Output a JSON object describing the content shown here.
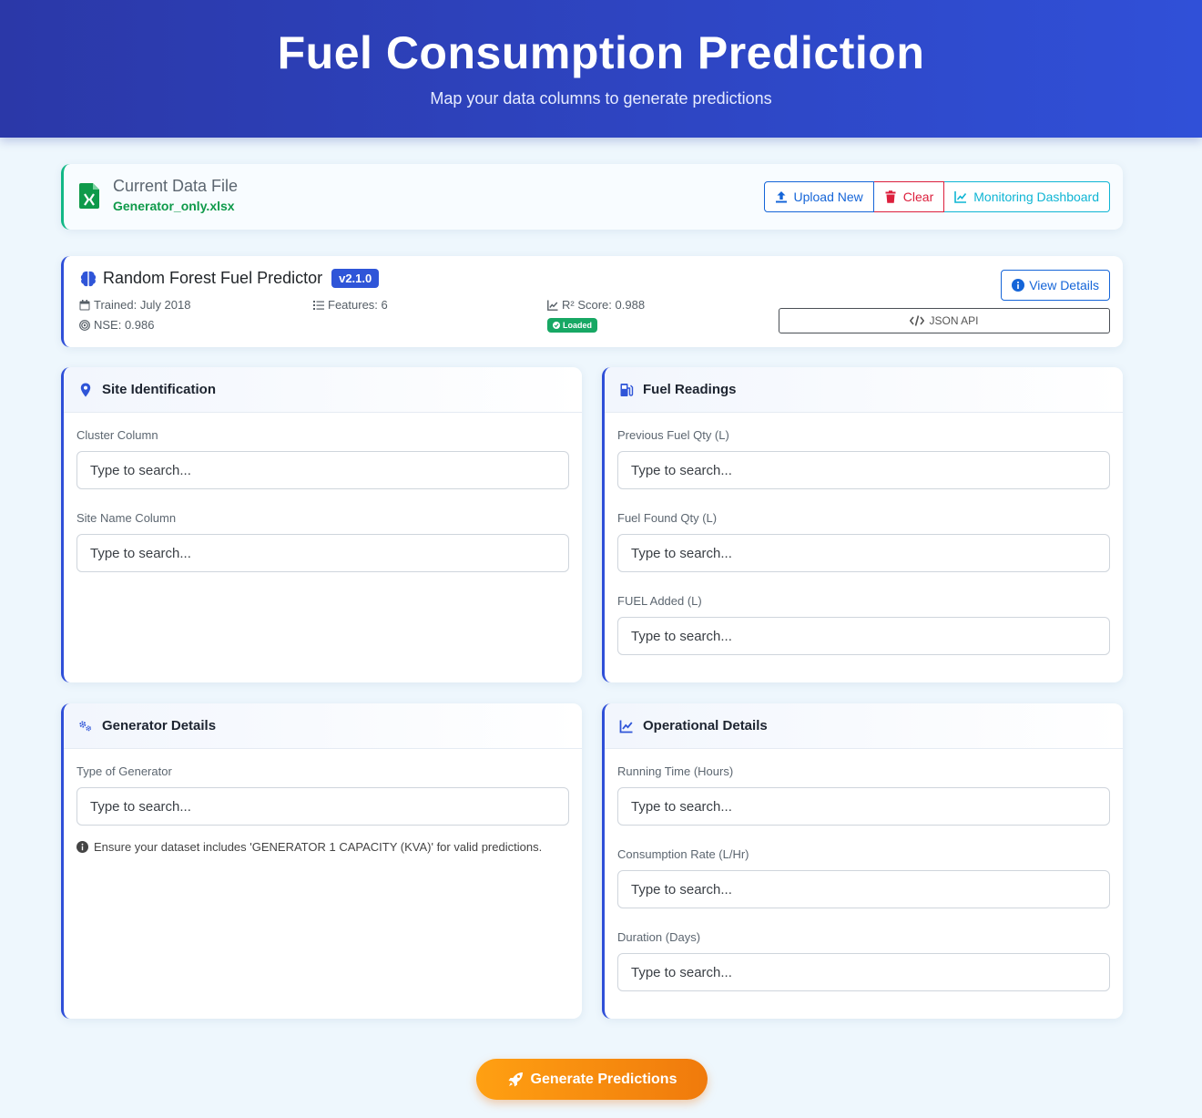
{
  "header": {
    "title": "Fuel Consumption Prediction",
    "subtitle": "Map your data columns to generate predictions"
  },
  "file": {
    "title": "Current Data File",
    "name": "Generator_only.xlsx",
    "buttons": {
      "upload": "Upload New",
      "clear": "Clear",
      "monitor": "Monitoring Dashboard"
    }
  },
  "model": {
    "name": "Random Forest Fuel Predictor",
    "version": "v2.1.0",
    "trained": "Trained: July 2018",
    "features": "Features: 6",
    "r2": "R² Score: 0.988",
    "nse": "NSE: 0.986",
    "status": "Loaded",
    "view_details": "View Details",
    "json_api": "JSON API"
  },
  "sections": {
    "site": {
      "title": "Site Identification",
      "fields": [
        {
          "label": "Cluster Column",
          "placeholder": "Type to search..."
        },
        {
          "label": "Site Name Column",
          "placeholder": "Type to search..."
        }
      ]
    },
    "fuel": {
      "title": "Fuel Readings",
      "fields": [
        {
          "label": "Previous Fuel Qty (L)",
          "placeholder": "Type to search..."
        },
        {
          "label": "Fuel Found Qty (L)",
          "placeholder": "Type to search..."
        },
        {
          "label": "FUEL Added (L)",
          "placeholder": "Type to search..."
        }
      ]
    },
    "generator": {
      "title": "Generator Details",
      "fields": [
        {
          "label": "Type of Generator",
          "placeholder": "Type to search..."
        }
      ],
      "note": "Ensure your dataset includes 'GENERATOR 1 CAPACITY (KVA)' for valid predictions."
    },
    "operational": {
      "title": "Operational Details",
      "fields": [
        {
          "label": "Running Time (Hours)",
          "placeholder": "Type to search..."
        },
        {
          "label": "Consumption Rate (L/Hr)",
          "placeholder": "Type to search..."
        },
        {
          "label": "Duration (Days)",
          "placeholder": "Type to search..."
        }
      ]
    }
  },
  "generate_label": "Generate Predictions",
  "colors": {
    "accent": "#2f4fd8",
    "success": "#0f9a4a",
    "danger": "#dc1f3c",
    "info": "#0fb5d4",
    "cta": "#f7900f"
  }
}
